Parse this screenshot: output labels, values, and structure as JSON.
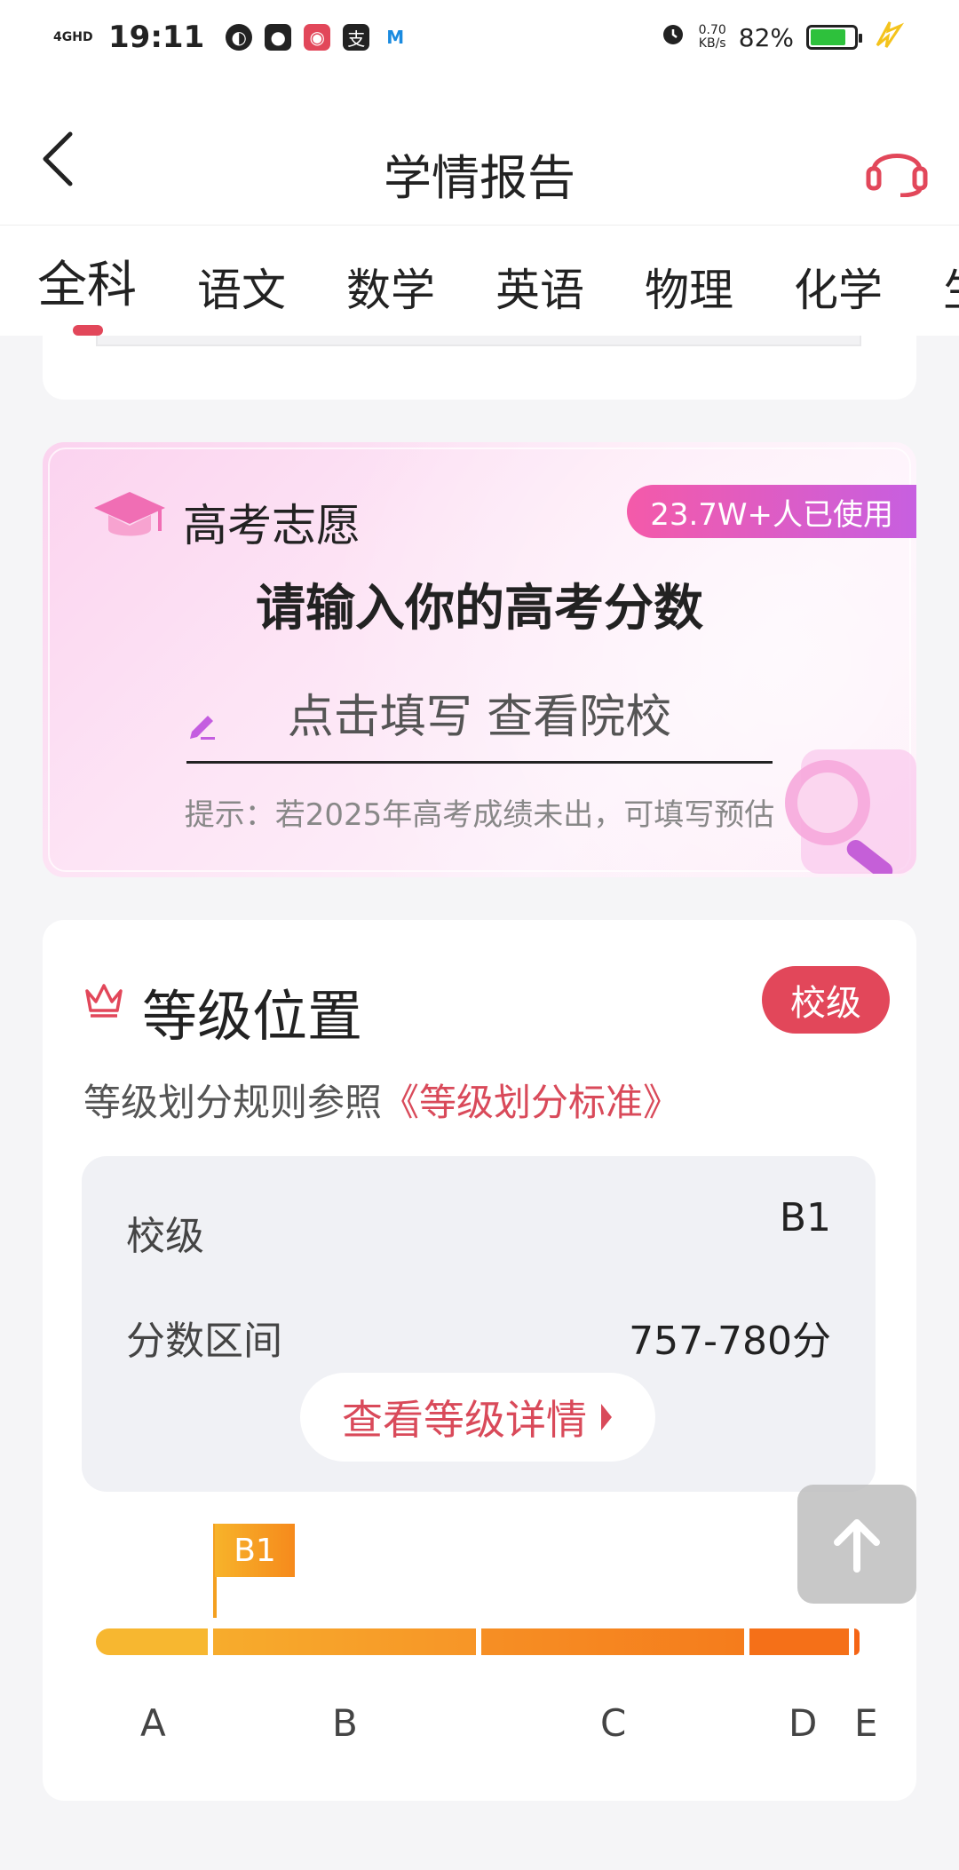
{
  "status_bar": {
    "network": "4GHD",
    "time": "19:11",
    "speed_value": "0.70",
    "speed_unit": "KB/s",
    "battery": "82%",
    "battery_level": 0.82
  },
  "header": {
    "title": "学情报告"
  },
  "tabs": [
    {
      "label": "全科",
      "active": true
    },
    {
      "label": "语文",
      "active": false
    },
    {
      "label": "数学",
      "active": false
    },
    {
      "label": "英语",
      "active": false
    },
    {
      "label": "物理",
      "active": false
    },
    {
      "label": "化学",
      "active": false
    },
    {
      "label": "生",
      "active": false
    }
  ],
  "gaokao": {
    "title": "高考志愿",
    "usage_badge": "23.7W+人已使用",
    "prompt": "请输入你的高考分数",
    "placeholder": "点击填写 查看院校",
    "hint": "提示：若2025年高考成绩未出，可填写预估"
  },
  "grade": {
    "title": "等级位置",
    "level_pill": "校级",
    "rule_prefix": "等级划分规则参照",
    "rule_link": "《等级划分标准》",
    "rows": [
      {
        "label": "校级",
        "value": "B1"
      },
      {
        "label": "分数区间",
        "value": "757-780分"
      }
    ],
    "detail_button": "查看等级详情",
    "flag": "B1",
    "scale_labels": [
      "A",
      "B",
      "C",
      "D",
      "E"
    ]
  },
  "colors": {
    "accent": "#e2475a",
    "link": "#d94a5a",
    "battery": "#2ec13c"
  }
}
